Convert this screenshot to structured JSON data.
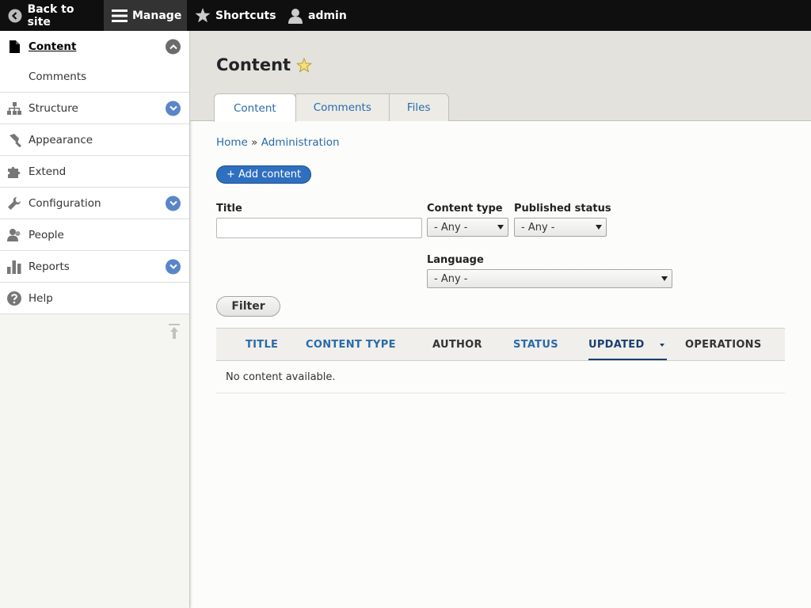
{
  "toolbar": {
    "back_label": "Back to site",
    "manage_label": "Manage",
    "shortcuts_label": "Shortcuts",
    "user_label": "admin"
  },
  "sidebar": {
    "items": [
      {
        "label": "Content",
        "icon": "file-icon"
      },
      {
        "label": "Comments"
      },
      {
        "label": "Structure",
        "icon": "sitemap-icon"
      },
      {
        "label": "Appearance",
        "icon": "paintbrush-icon"
      },
      {
        "label": "Extend",
        "icon": "puzzle-icon"
      },
      {
        "label": "Configuration",
        "icon": "wrench-icon"
      },
      {
        "label": "People",
        "icon": "people-icon"
      },
      {
        "label": "Reports",
        "icon": "bar-chart-icon"
      },
      {
        "label": "Help",
        "icon": "help-icon"
      }
    ]
  },
  "page": {
    "title": "Content",
    "tabs": [
      {
        "label": "Content",
        "active": true
      },
      {
        "label": "Comments",
        "active": false
      },
      {
        "label": "Files",
        "active": false
      }
    ],
    "breadcrumb": {
      "home": "Home",
      "sep": "»",
      "admin": "Administration"
    },
    "add_button": "+ Add content"
  },
  "filters": {
    "title_label": "Title",
    "title_value": "",
    "content_type_label": "Content type",
    "content_type_value": "- Any -",
    "published_label": "Published status",
    "published_value": "- Any -",
    "language_label": "Language",
    "language_value": "- Any -",
    "filter_button": "Filter"
  },
  "table": {
    "columns": [
      "TITLE",
      "CONTENT TYPE",
      "AUTHOR",
      "STATUS",
      "UPDATED",
      "OPERATIONS"
    ],
    "empty_message": "No content available."
  },
  "colors": {
    "link": "#2a6aab",
    "primary_button": "#2f6fbf",
    "toolbar": "#0f0f0f"
  }
}
